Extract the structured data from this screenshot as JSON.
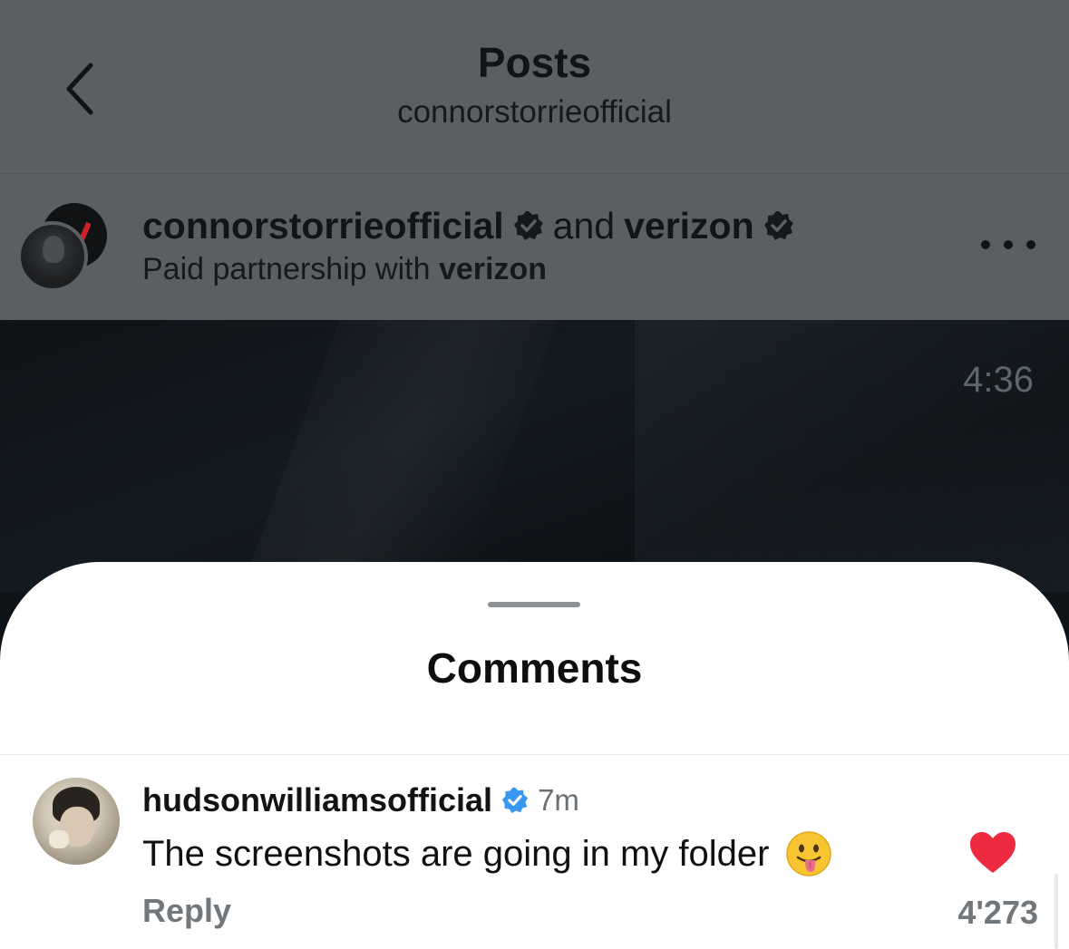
{
  "header": {
    "title": "Posts",
    "subtitle": "connorstorrieofficial",
    "back_icon": "chevron-left-icon"
  },
  "post": {
    "author": "connorstorrieofficial",
    "joiner": "and",
    "coauthor": "verizon",
    "partnership_prefix": "Paid partnership with",
    "partnership_brand": "verizon",
    "verified_icon": "verified-badge-icon",
    "more_icon": "more-horizontal-icon"
  },
  "video": {
    "time_remaining": "4:36"
  },
  "comments_sheet": {
    "title": "Comments",
    "comments": [
      {
        "username": "hudsonwilliamsofficial",
        "time": "7m",
        "text": "The screenshots are going in my folder",
        "emoji": "face-with-tongue-icon",
        "reply_label": "Reply",
        "like_count": "4'273",
        "liked": true
      }
    ]
  },
  "colors": {
    "dimmed_bg": "#5b5f63",
    "verified_blue": "#3897f0",
    "like_red": "#ed2a3f",
    "muted_text": "#72777c"
  }
}
